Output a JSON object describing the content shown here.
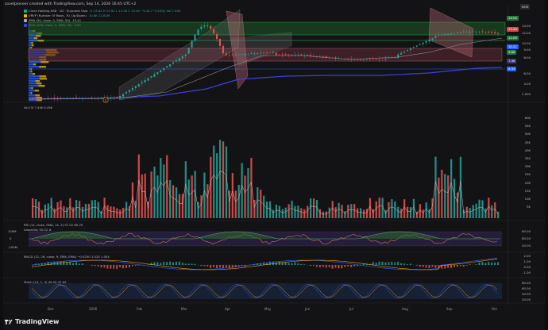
{
  "header": {
    "title": "sovelpioneer created with TradingView.com, Sep 14, 2026 16:45 UTC+2"
  },
  "currency": "NOK",
  "main_legend": [
    {
      "label": "Circle Holding ASÃ · 1D · Euronext Oslo",
      "values": "O 13.82  H 13.92  L 13.28  C 13.40  −0.44 (−3.20%)  Vol 7.44K",
      "color": "#26a69a"
    },
    {
      "label": "VRVP (Number Of Rows, 70, Up/Down)",
      "values": "10.8K  12.81M",
      "color": "#f0b90b"
    },
    {
      "label": "SMA (50, close, 0, SMA, 50)",
      "values": "13.41",
      "color": "#a8a8a8"
    },
    {
      "label": "SMA (200, close, 0, SMA, 50)",
      "values": "5.81",
      "color": "#3b40e0"
    }
  ],
  "price_axis": [
    "14.00",
    "12.00",
    "10.00",
    "9.00",
    "8.00",
    "6.00",
    "4.00",
    "2.000"
  ],
  "price_tags": [
    {
      "label": "14.00",
      "color": "#1e7a3a"
    },
    {
      "label": "13.40",
      "color": "#d9484a"
    },
    {
      "label": "12.00",
      "color": "#1e7a3a"
    },
    {
      "label": "10.21",
      "color": "#2962ff"
    },
    {
      "label": "9.86",
      "color": "#1e7a3a"
    },
    {
      "label": "7.46",
      "color": "#3a3a7a"
    },
    {
      "label": "6.34",
      "color": "#2962ff"
    }
  ],
  "earnings_marker": "E",
  "vol_legend": "Vol (3)  7.44k  5.45K",
  "vol_axis": [
    "60K",
    "55K",
    "50K",
    "45K",
    "40K",
    "35K",
    "30K",
    "25K",
    "20K",
    "15K",
    "10K",
    "5K"
  ],
  "rsi_legend": "RSI (14, close, SMA, 14, 2)  57.02  60.29",
  "rsi_sub_legend": "AroonOsc  50.52 #",
  "rsi_axis": [
    "80.00",
    "60.00",
    "40.00"
  ],
  "rsi_left_axis": [
    "100M",
    "0",
    "-100M"
  ],
  "macd_legend": "MACD (12, 26, close, 9, EMA, EMA)  −0.0250  1.025  1.054",
  "macd_axis": [
    "2.00",
    "1.00",
    "0.00",
    "-1.00"
  ],
  "stoch_legend": "Stoch (14, 1, 3)  49.34  47.92",
  "stoch_axis": [
    "80.00",
    "60.00",
    "40.00",
    "20.00"
  ],
  "time_axis": [
    "Dec",
    "2026",
    "Feb",
    "Mar",
    "Apr",
    "May",
    "Jun",
    "Jul",
    "Aug",
    "Sep",
    "Oct"
  ],
  "brand": "TradingView",
  "colors": {
    "up": "#26a69a",
    "down": "#ef5350",
    "sma200": "#3b40e0",
    "bg": "#131316"
  }
}
